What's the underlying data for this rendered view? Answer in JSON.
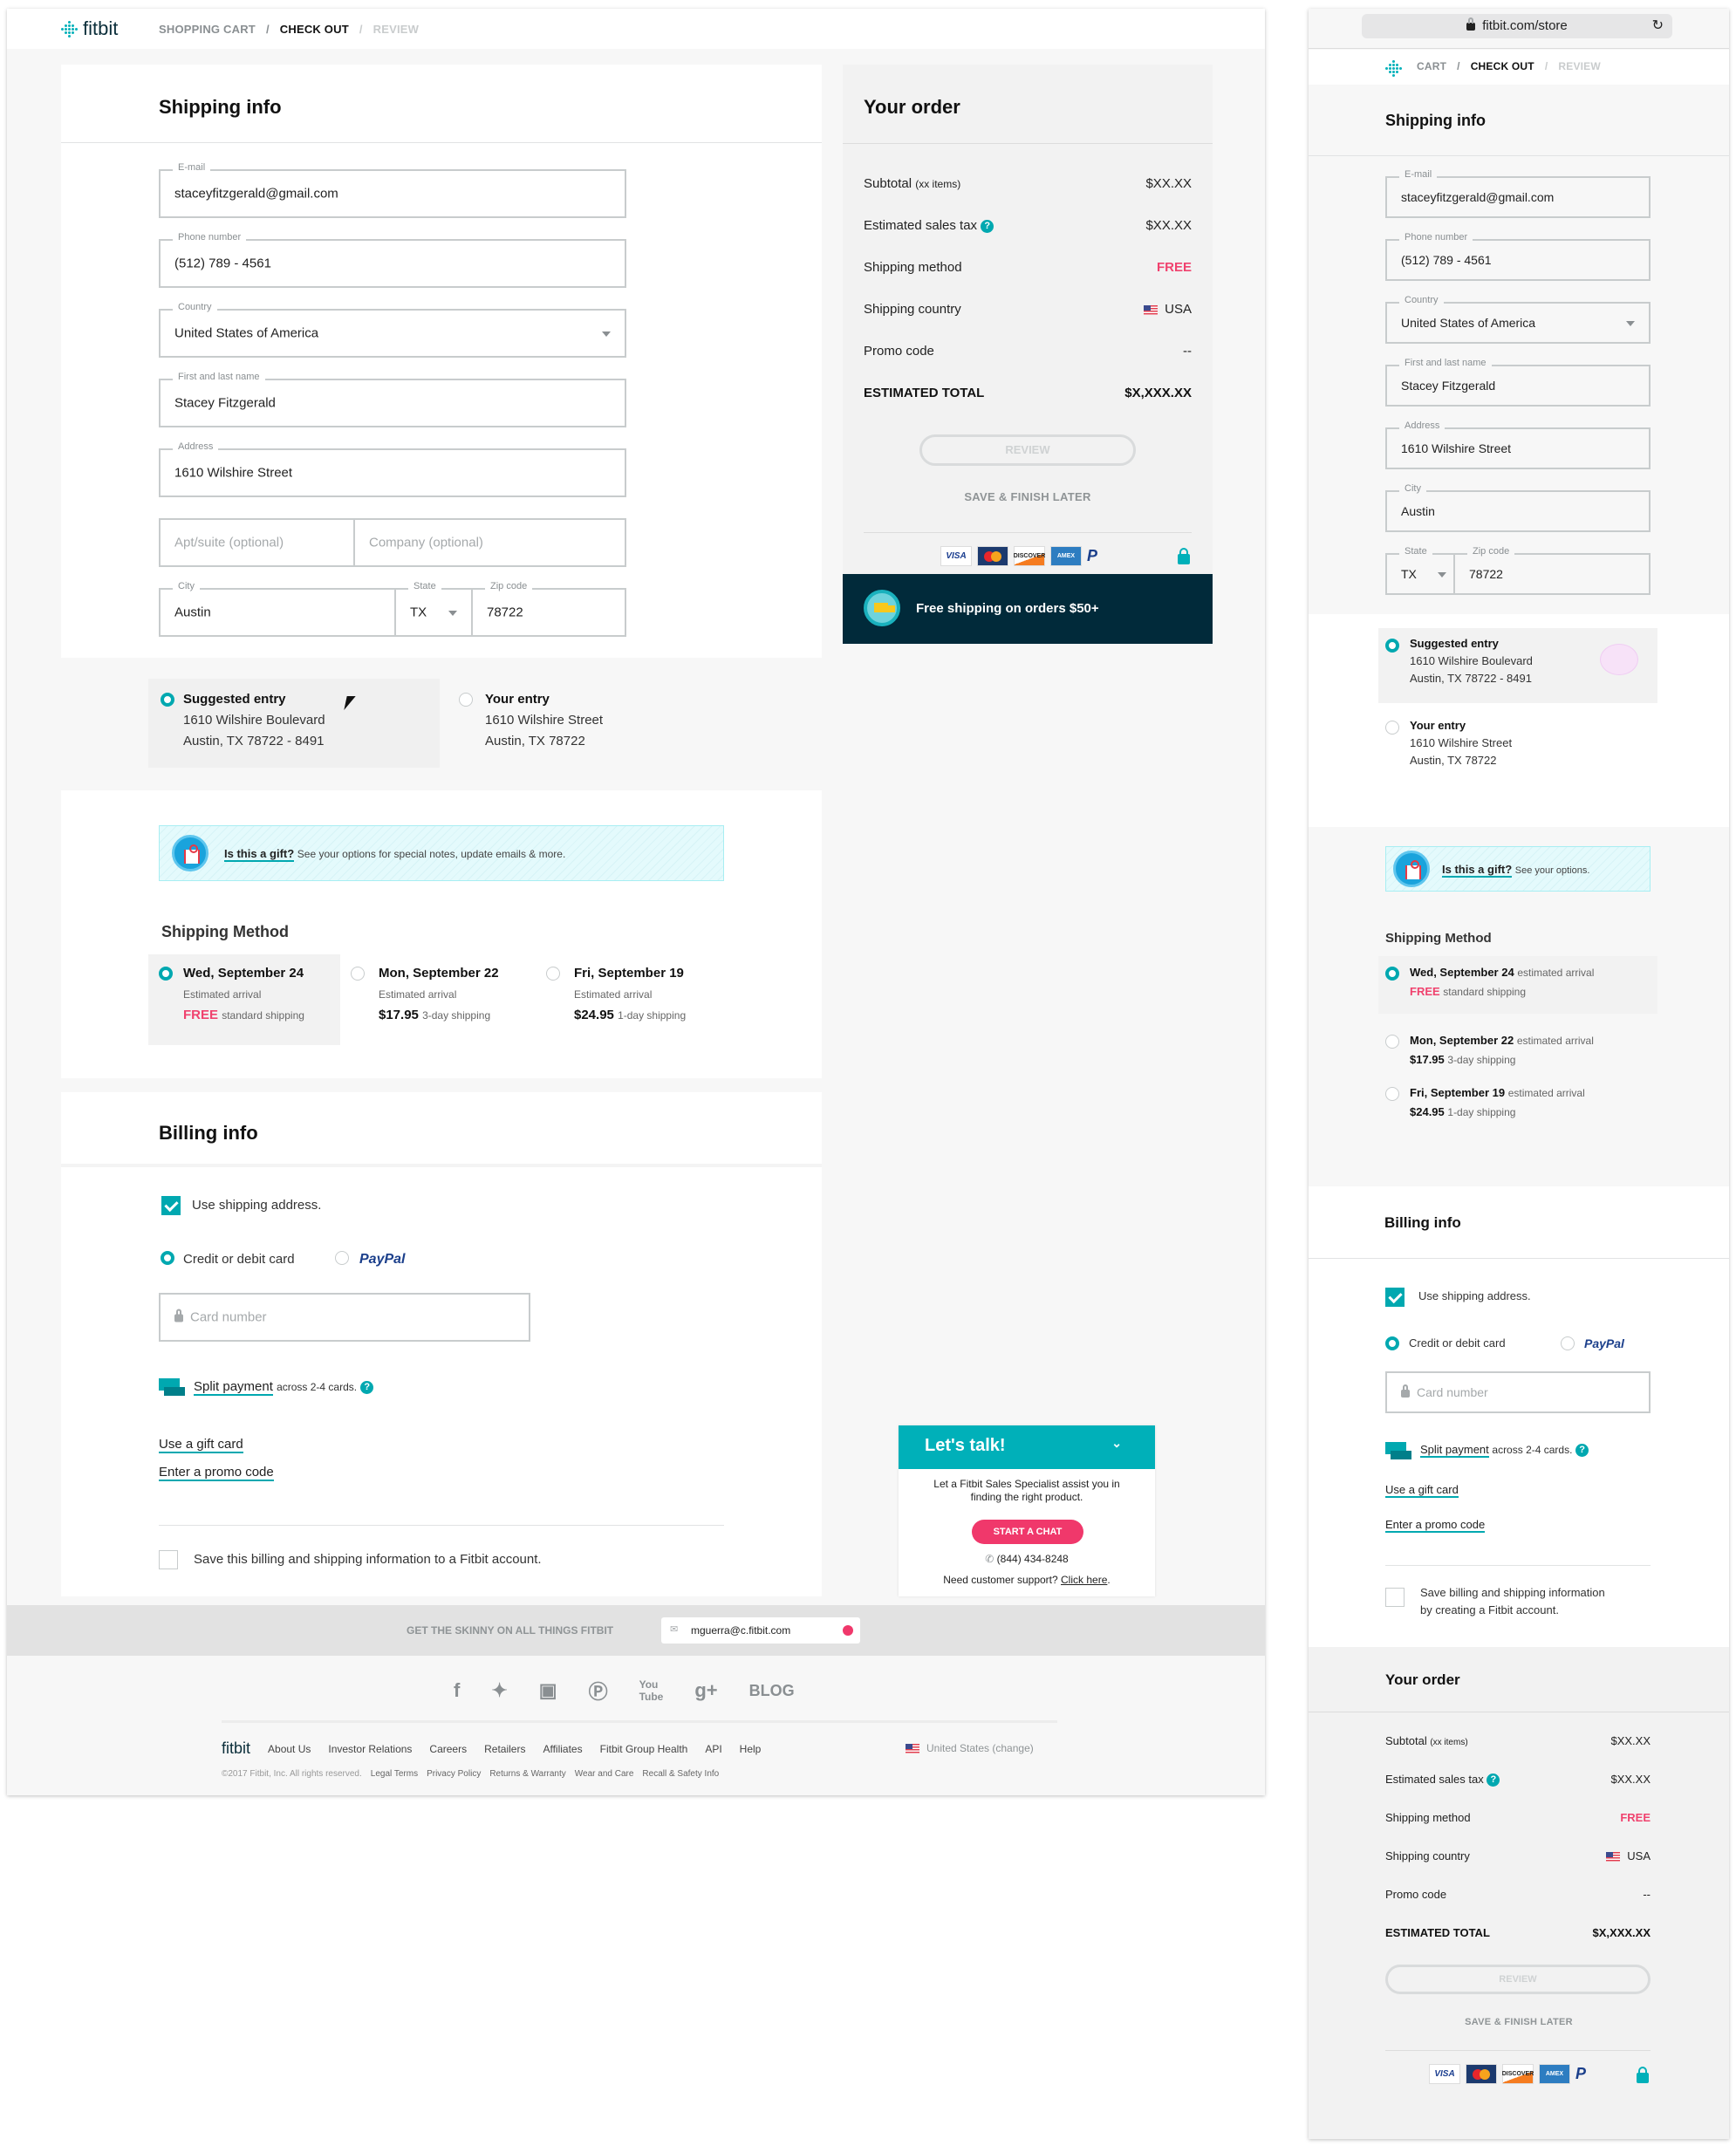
{
  "desktop": {
    "header": {
      "logo_text": "fitbit",
      "breadcrumbs": [
        {
          "label": "SHOPPING CART",
          "state": "visited"
        },
        {
          "label": "CHECK OUT",
          "state": "active"
        },
        {
          "label": "REVIEW",
          "state": "disabled"
        }
      ],
      "separator": "/"
    },
    "shipping": {
      "title": "Shipping info",
      "fields": {
        "email": {
          "label": "E-mail",
          "value": "staceyfitzgerald@gmail.com"
        },
        "phone": {
          "label": "Phone number",
          "value": "(512) 789 - 4561"
        },
        "country": {
          "label": "Country",
          "value": "United States of America"
        },
        "name": {
          "label": "First and last name",
          "value": "Stacey Fitzgerald"
        },
        "address": {
          "label": "Address",
          "value": "1610 Wilshire Street"
        },
        "apt": {
          "placeholder": "Apt/suite (optional)"
        },
        "company": {
          "placeholder": "Company (optional)"
        },
        "city": {
          "label": "City",
          "value": "Austin"
        },
        "state": {
          "label": "State",
          "value": "TX"
        },
        "zip": {
          "label": "Zip code",
          "value": "78722"
        }
      },
      "address_suggestions": [
        {
          "title": "Suggested entry",
          "line1": "1610 Wilshire Boulevard",
          "line2": "Austin, TX  78722 - 8491",
          "selected": true
        },
        {
          "title": "Your entry",
          "line1": "1610 Wilshire Street",
          "line2": "Austin, TX  78722",
          "selected": false
        }
      ]
    },
    "gift": {
      "link": "Is this a gift?",
      "text": "See your options for special notes, update emails & more."
    },
    "shipping_method": {
      "title": "Shipping Method",
      "options": [
        {
          "date": "Wed, September 24",
          "sub": "Estimated arrival",
          "price": "FREE",
          "desc": "standard shipping",
          "selected": true
        },
        {
          "date": "Mon, September 22",
          "sub": "Estimated arrival",
          "price": "$17.95",
          "desc": "3-day shipping",
          "selected": false
        },
        {
          "date": "Fri, September 19",
          "sub": "Estimated arrival",
          "price": "$24.95",
          "desc": "1-day shipping",
          "selected": false
        }
      ]
    },
    "billing": {
      "title": "Billing info",
      "use_shipping": {
        "label": "Use shipping address.",
        "checked": true
      },
      "payment_options": [
        {
          "label": "Credit or debit card",
          "selected": true
        },
        {
          "label": "PayPal",
          "selected": false
        }
      ],
      "card_placeholder": "Card number",
      "split_link": "Split payment",
      "split_text": "across 2-4 cards.",
      "gift_card_link": "Use a gift card",
      "promo_link": "Enter a promo code",
      "save": {
        "label": "Save this billing and shipping information to a Fitbit account.",
        "checked": false
      }
    },
    "order": {
      "title": "Your order",
      "rows": [
        {
          "label": "Subtotal",
          "note": "(xx items)",
          "value": "$XX.XX"
        },
        {
          "label": "Estimated sales tax",
          "help": true,
          "value": "$XX.XX"
        },
        {
          "label": "Shipping method",
          "value": "FREE",
          "accent": true
        },
        {
          "label": "Shipping country",
          "value": "USA",
          "flag": true
        },
        {
          "label": "Promo code",
          "value": "--"
        }
      ],
      "total": {
        "label": "ESTIMATED TOTAL",
        "value": "$X,XXX.XX"
      },
      "review_button": "REVIEW",
      "save_later": "SAVE & FINISH LATER",
      "payment_icons": [
        "VISA",
        "MasterCard",
        "DISCOVER",
        "AMERICAN EXPRESS",
        "PayPal"
      ],
      "banner": "Free shipping on orders $50+"
    },
    "chat": {
      "title": "Let's talk!",
      "body": "Let a Fitbit Sales Specialist assist you in finding the right product.",
      "button": "START A CHAT",
      "phone": "(844) 434-8248",
      "support_text": "Need customer support?",
      "support_link": "Click here"
    },
    "footer": {
      "newsletter_label": "GET THE SKINNY ON ALL THINGS FITBIT",
      "newsletter_value": "mguerra@c.fitbit.com",
      "social": [
        "facebook",
        "twitter",
        "instagram",
        "pinterest",
        "youtube",
        "google-plus"
      ],
      "blog": "BLOG",
      "links": [
        "About Us",
        "Investor Relations",
        "Careers",
        "Retailers",
        "Affiliates",
        "Fitbit Group Health",
        "API",
        "Help"
      ],
      "region": "United States",
      "region_change": "(change)",
      "copyright": "©2017 Fitbit, Inc. All rights reserved.",
      "legal_links": [
        "Legal Terms",
        "Privacy Policy",
        "Returns & Warranty",
        "Wear and Care",
        "Recall & Safety Info"
      ]
    }
  },
  "mobile": {
    "url": "fitbit.com/store",
    "breadcrumbs": [
      {
        "label": "CART",
        "state": "visited"
      },
      {
        "label": "CHECK OUT",
        "state": "active"
      },
      {
        "label": "REVIEW",
        "state": "disabled"
      }
    ],
    "shipping_title": "Shipping info",
    "fields": {
      "email": {
        "label": "E-mail",
        "value": "staceyfitzgerald@gmail.com"
      },
      "phone": {
        "label": "Phone number",
        "value": "(512) 789 - 4561"
      },
      "country": {
        "label": "Country",
        "value": "United States of America"
      },
      "name": {
        "label": "First and last name",
        "value": "Stacey Fitzgerald"
      },
      "address": {
        "label": "Address",
        "value": "1610 Wilshire Street"
      },
      "city": {
        "label": "City",
        "value": "Austin"
      },
      "state": {
        "label": "State",
        "value": "TX"
      },
      "zip": {
        "label": "Zip code",
        "value": "78722"
      }
    },
    "address_suggestions": [
      {
        "title": "Suggested entry",
        "line1": "1610 Wilshire Boulevard",
        "line2": "Austin, TX  78722 - 8491",
        "selected": true
      },
      {
        "title": "Your entry",
        "line1": "1610 Wilshire Street",
        "line2": "Austin, TX  78722",
        "selected": false
      }
    ],
    "gift": {
      "link": "Is this a gift?",
      "text": "See your options."
    },
    "shipping_method_title": "Shipping Method",
    "shipping_options": [
      {
        "date": "Wed, September 24",
        "sub": "estimated arrival",
        "price": "FREE",
        "desc": "standard shipping",
        "selected": true
      },
      {
        "date": "Mon, September 22",
        "sub": "estimated arrival",
        "price": "$17.95",
        "desc": "3-day shipping",
        "selected": false
      },
      {
        "date": "Fri, September 19",
        "sub": "estimated arrival",
        "price": "$24.95",
        "desc": "1-day shipping",
        "selected": false
      }
    ],
    "billing_title": "Billing info",
    "use_shipping": "Use shipping address.",
    "card_option": "Credit or debit card",
    "paypal_option": "PayPal",
    "card_placeholder": "Card number",
    "split_link": "Split payment",
    "split_text": "across 2-4 cards.",
    "gift_card_link": "Use a gift card",
    "promo_link": "Enter a promo code",
    "save_line1": "Save billing and shipping information",
    "save_line2": "by creating a Fitbit account.",
    "order_title": "Your order",
    "order_rows": [
      {
        "label": "Subtotal",
        "note": "(xx items)",
        "value": "$XX.XX"
      },
      {
        "label": "Estimated sales tax",
        "value": "$XX.XX"
      },
      {
        "label": "Shipping method",
        "value": "FREE"
      },
      {
        "label": "Shipping country",
        "value": "USA"
      },
      {
        "label": "Promo code",
        "value": "--"
      }
    ],
    "total_label": "ESTIMATED TOTAL",
    "total_value": "$X,XXX.XX",
    "review_button": "REVIEW",
    "save_later": "SAVE & FINISH LATER"
  },
  "colors": {
    "accent": "#00a8b0",
    "pink": "#f0426e",
    "navy": "#012a3a"
  }
}
